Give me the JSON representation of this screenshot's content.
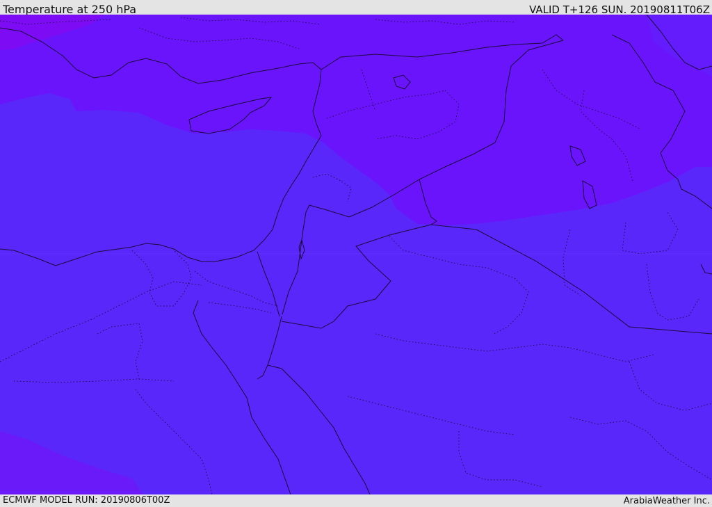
{
  "header": {
    "title": "Temperature at 250 hPa",
    "valid": "VALID T+126 SUN. 20190811T06Z"
  },
  "footer": {
    "model_run": "ECMWF MODEL RUN: 20190806T00Z",
    "credit": "ArabiaWeather Inc."
  },
  "map": {
    "field": "temperature",
    "level": "250 hPa",
    "colors": {
      "cold_zone": "#6a14fc",
      "mid_zone": "#5a27fb",
      "northwest_corner": "#7d0cf5",
      "southwest_corner": "#6a1af8",
      "coastline": "#1a0a3a",
      "border": "#1a0a3a"
    }
  }
}
